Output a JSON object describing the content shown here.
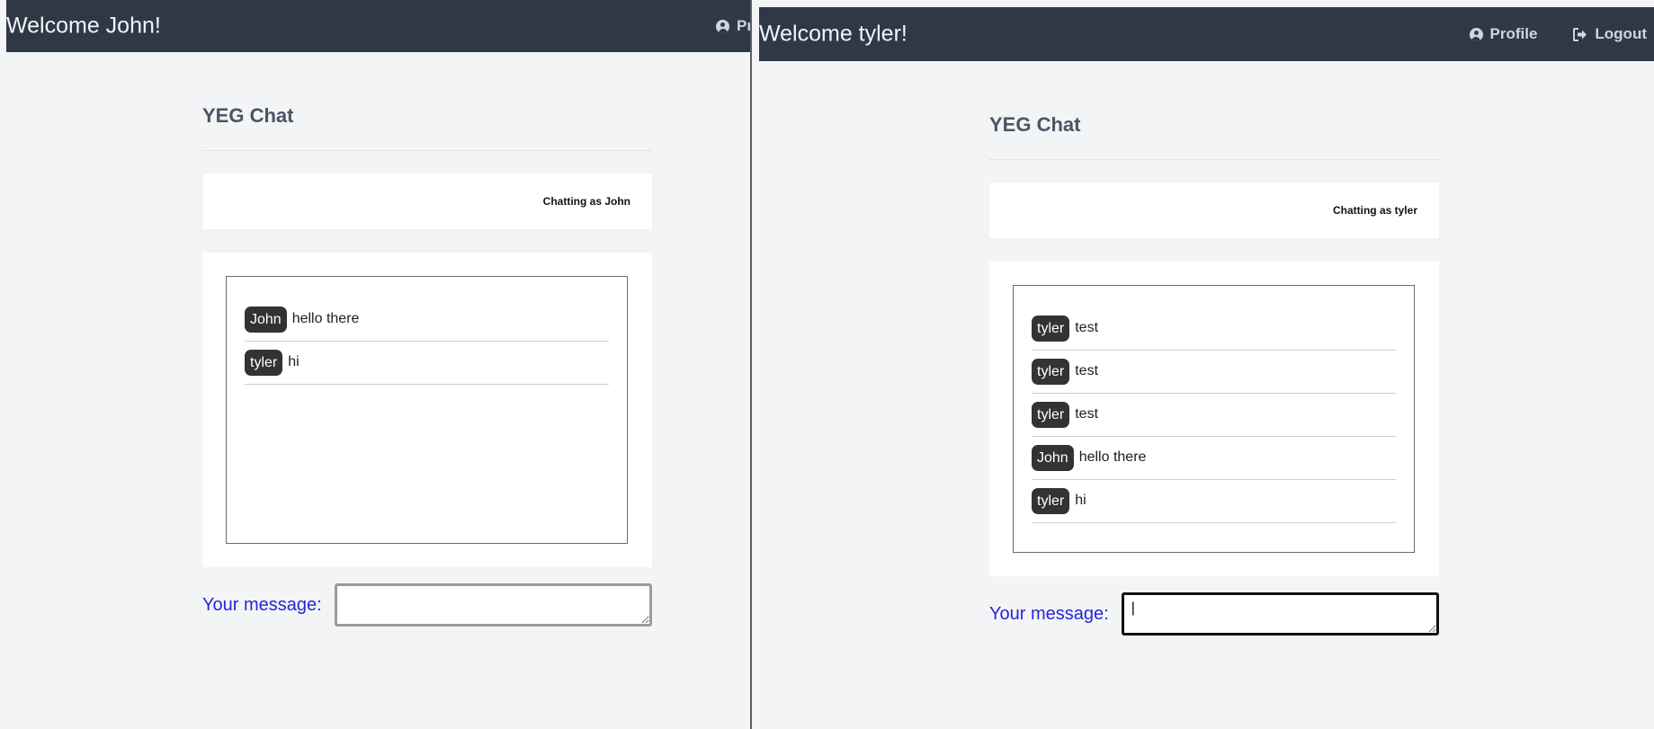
{
  "left_window": {
    "header": {
      "title": "Welcome John!",
      "profile_label": "Pr"
    },
    "chat_title": "YEG Chat",
    "status": "Chatting as John",
    "messages": [
      {
        "user": "John",
        "text": "hello there"
      },
      {
        "user": "tyler",
        "text": "hi"
      }
    ],
    "compose": {
      "label": "Your message:",
      "value": ""
    }
  },
  "right_window": {
    "header": {
      "title": "Welcome tyler!",
      "profile_label": "Profile",
      "logout_label": "Logout"
    },
    "chat_title": "YEG Chat",
    "status": "Chatting as tyler",
    "messages": [
      {
        "user": "tyler",
        "text": "test"
      },
      {
        "user": "tyler",
        "text": "test"
      },
      {
        "user": "tyler",
        "text": "test"
      },
      {
        "user": "John",
        "text": "hello there"
      },
      {
        "user": "tyler",
        "text": "hi"
      }
    ],
    "compose": {
      "label": "Your message:",
      "value": "|"
    }
  },
  "colors": {
    "navbar_bg": "#2f3847",
    "page_bg": "#f3f4f6",
    "label_blue": "#2626d4",
    "badge_bg": "#333333"
  },
  "icons": {
    "profile": "user-circle-icon",
    "logout": "logout-icon"
  }
}
